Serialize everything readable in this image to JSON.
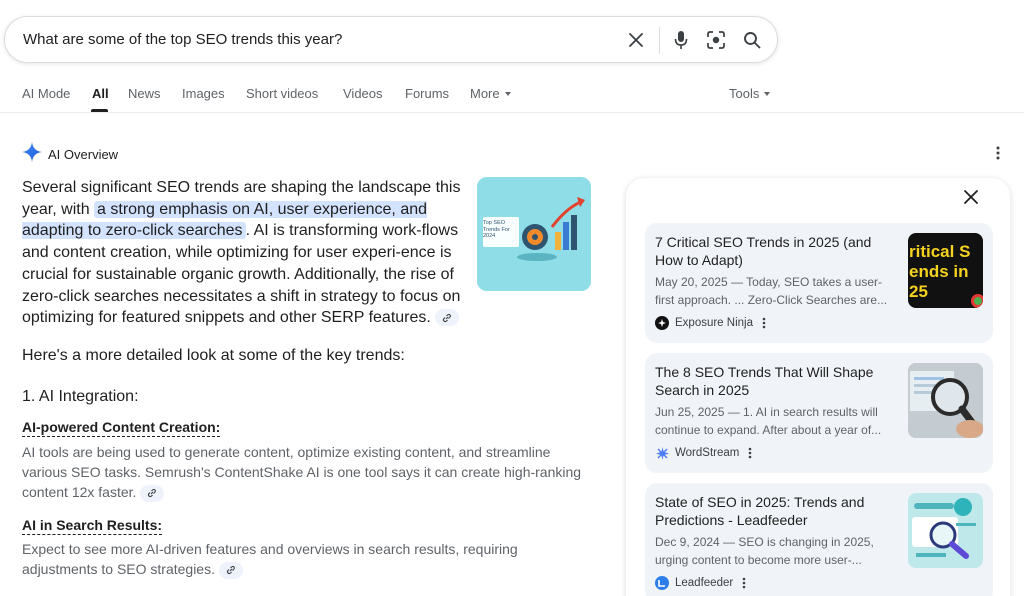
{
  "search": {
    "query": "What are some of the top SEO trends this year?"
  },
  "tabs": [
    {
      "label": "AI Mode"
    },
    {
      "label": "All",
      "active": true
    },
    {
      "label": "News"
    },
    {
      "label": "Images"
    },
    {
      "label": "Short videos"
    },
    {
      "label": "Videos"
    },
    {
      "label": "Forums"
    },
    {
      "label": "More"
    }
  ],
  "tools_label": "Tools",
  "ai_overview": {
    "title": "AI Overview",
    "para1_a": "Several significant SEO trends are shaping the landscape this year, with ",
    "para1_hl": "a strong emphasis on AI, user experience, and adapting to zero-click searches",
    "para1_b": ". AI is transforming work-flows and content creation, while optimizing for user experi-ence is crucial for sustainable organic growth. Additionally, the rise of zero-click searches necessitates a shift in strategy to focus on optimizing for featured snippets and other SERP features.",
    "thumb_text": "Top SEO Trends For 2024",
    "intro": "Here's a more detailed look at some of the key trends:",
    "section_heading": "1. AI Integration:",
    "items": [
      {
        "heading": "AI-powered Content Creation:",
        "body": "AI tools are being used to generate content, optimize existing content, and streamline various SEO tasks. Semrush's ContentShake AI is one tool says it can create high-ranking content 12x faster."
      },
      {
        "heading": "AI in Search Results:",
        "body": "Expect to see more AI-driven features and overviews in search results, requiring adjustments to SEO strategies."
      }
    ]
  },
  "sources": [
    {
      "title": "7 Critical SEO Trends in 2025 (and How to Adapt)",
      "snippet": "May 20, 2025 — Today, SEO takes a user-first approach. ... Zero-Click Searches are...",
      "source": "Exposure Ninja",
      "image_text": "ritical S\nends in\n25",
      "favicon_color": "#000000"
    },
    {
      "title": "The 8 SEO Trends That Will Shape Search in 2025",
      "snippet": "Jun 25, 2025 — 1. AI in search results will continue to expand. After about a year of...",
      "source": "WordStream",
      "favicon_color": "#4a7cf7"
    },
    {
      "title": "State of SEO in 2025: Trends and Predictions - Leadfeeder",
      "snippet": "Dec 9, 2024 — SEO is changing in 2025, urging content to become more user-...",
      "source": "Leadfeeder",
      "favicon_color": "#2b7de9"
    }
  ],
  "colors": {
    "highlight": "#d3e3fd",
    "card_bg": "#f0f4f9",
    "accent_blue": "#1a73e8"
  }
}
